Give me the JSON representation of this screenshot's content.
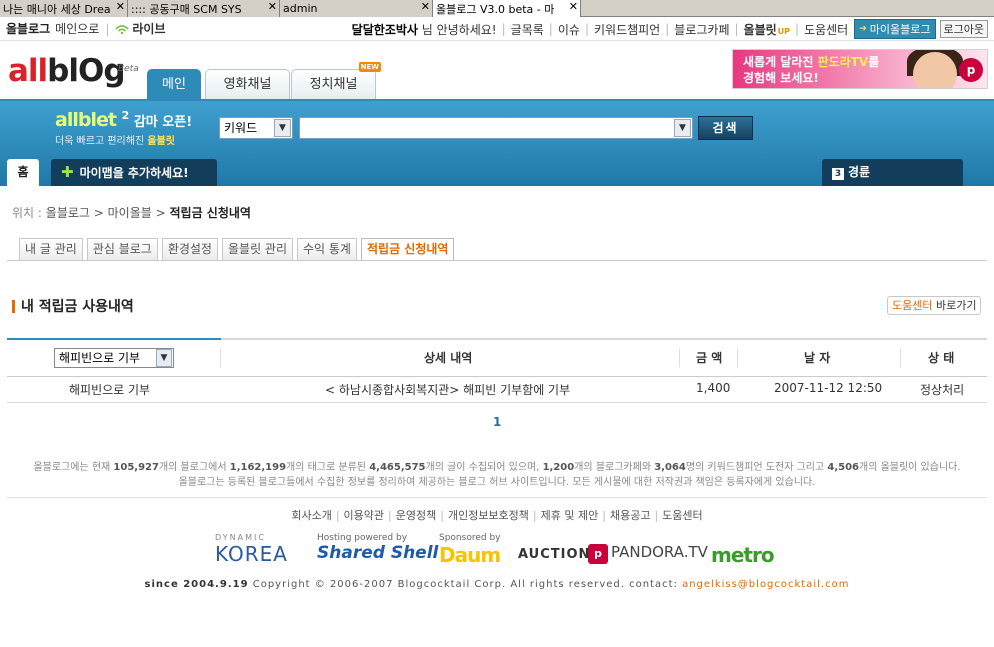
{
  "browser_tabs": [
    {
      "label": "나는 매니아 세상 Drea",
      "active": false
    },
    {
      "label": ":::: 공동구매 SCM SYS",
      "active": false
    },
    {
      "label": "admin",
      "active": false
    },
    {
      "label": "올블로그 V3.0 beta - 마",
      "active": true
    }
  ],
  "topbar": {
    "site_name": "올블로그",
    "main_link": "메인으로",
    "live": "라이브",
    "greeting_user": "달달한조박사",
    "greeting_suffix": "님 안녕하세요!",
    "links": [
      "글목록",
      "이슈",
      "키워드챔피언",
      "블로그카페"
    ],
    "allblet": "올블릿",
    "allblet_badge": "UP",
    "help": "도움센터",
    "myblog_button": "마이올블로그",
    "logout_button": "로그아웃"
  },
  "header": {
    "logo_red": "all",
    "logo_dark": "blOg",
    "logo_beta": "Beta",
    "tabs": [
      {
        "label": "메인",
        "active": true
      },
      {
        "label": "영화채널",
        "active": false
      },
      {
        "label": "정치채널",
        "active": false,
        "badge": "NEW"
      }
    ],
    "ad": {
      "line1_a": "새롭게 달라진 ",
      "line1_hl": "판도라TV",
      "line1_b": "를",
      "line2": "경험해 보세요!"
    }
  },
  "search": {
    "promo_title": "allblet",
    "promo_sup": "2",
    "promo_word": "감마 오픈!",
    "promo_sub_a": "더욱 빠르고 편리해진 ",
    "promo_sub_b": "올블릿",
    "select_value": "키워드",
    "query": "",
    "button": "검색"
  },
  "maptabs": {
    "home": "홈",
    "add": "마이맵을 추가하세요!",
    "routes_num": "3",
    "routes": "경륜"
  },
  "breadcrumb": {
    "label": "위치 :",
    "items": [
      "올블로그",
      "마이올블",
      "적립금 신청내역"
    ]
  },
  "subtabs": [
    {
      "label": "내 글 관리",
      "active": false
    },
    {
      "label": "관심 블로그",
      "active": false
    },
    {
      "label": "환경설정",
      "active": false
    },
    {
      "label": "올블릿 관리",
      "active": false
    },
    {
      "label": "수익 통계",
      "active": false
    },
    {
      "label": "적립금 신청내역",
      "active": true
    }
  ],
  "section": {
    "title": "내 적립금 사용내역",
    "help_a": "도움센터",
    "help_b": "바로가기"
  },
  "table": {
    "filter_value": "해피빈으로 기부",
    "headers": [
      "상세 내역",
      "금 액",
      "날 자",
      "상 태"
    ],
    "rows": [
      {
        "type": "해피빈으로 기부",
        "detail": "< 하남시종합사회복지관> 해피빈 기부함에 기부",
        "amount": "1,400",
        "date": "2007-11-12 12:50",
        "status": "정상처리"
      }
    ]
  },
  "pager": {
    "current": "1"
  },
  "footer": {
    "stats_a": "올블로그에는 현재 ",
    "blogs": "105,927",
    "stats_b": "개의 블로그에서 ",
    "tags": "1,162,199",
    "stats_c": "개의 태그로 분류된 ",
    "posts": "4,465,575",
    "stats_d": "개의 글이 수집되어 있으며, ",
    "cafes": "1,200",
    "stats_e": "개의 블로그카페와 ",
    "people": "3,064",
    "stats_f": "명의 키워드챔피언 도전자 그리고 ",
    "allblets": "4,506",
    "stats_g": "개의 올블릿이 있습니다.",
    "disclaimer": "올블로그는 등록된 블로그들에서 수집한 정보를 정리하여 제공하는 블로그 허브 사이트입니다. 모든 게시물에 대한 저작권과 책임은 등록자에게 있습니다.",
    "links": [
      "회사소개",
      "이용약관",
      "운영정책",
      "개인정보보호정책",
      "제휴 및 제안",
      "채용공고",
      "도움센터"
    ],
    "sponsors": {
      "dk_small": "DYNAMIC",
      "dk_big": "KOREA",
      "ss_small": "Hosting powered by",
      "ss_big": "Shared Shell",
      "dm_small": "Sponsored by",
      "dm_big": "Daum",
      "auction": "AUCTION",
      "pandora": "PANDORA.TV",
      "metro": "metro"
    },
    "since": "since 2004.9.19",
    "copyright": "Copyright © 2006-2007 Blogcocktail Corp. All rights reserved. contact:",
    "email": "angelkiss@blogcocktail.com"
  }
}
